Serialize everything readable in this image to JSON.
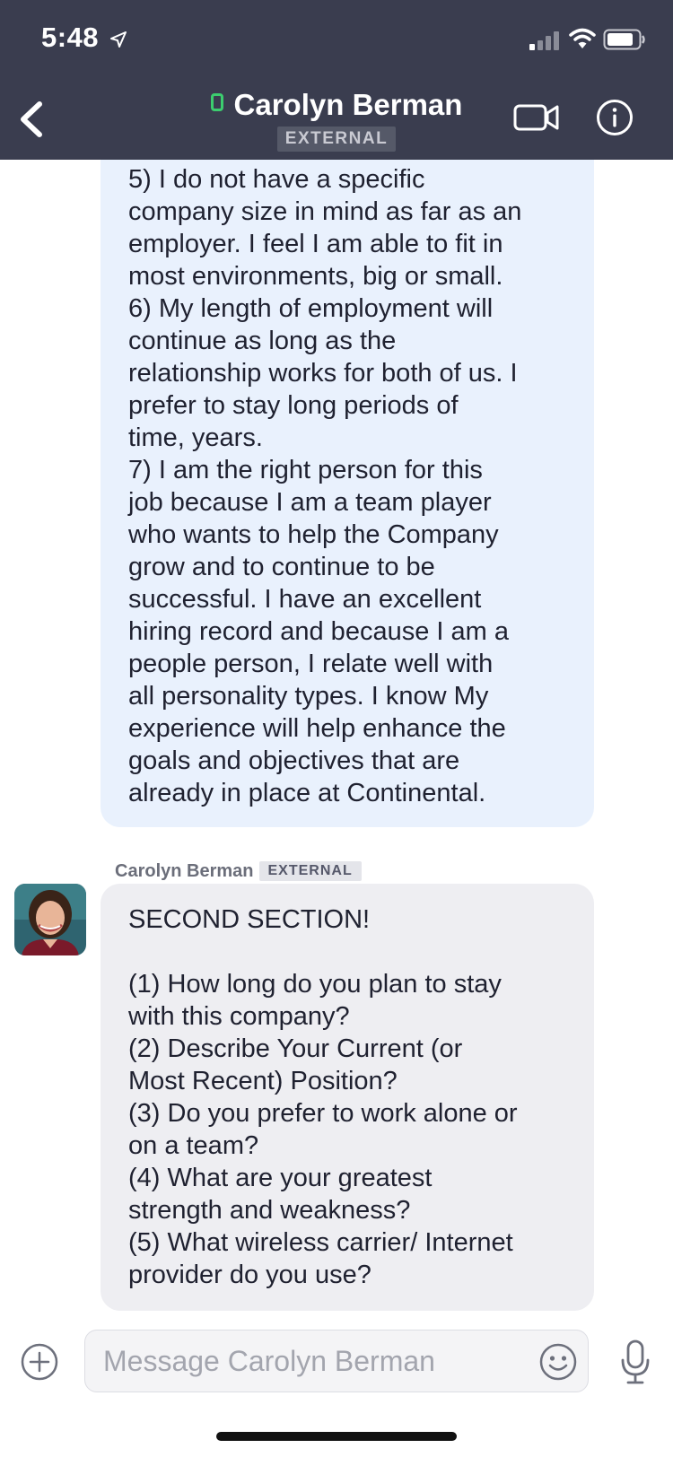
{
  "status_bar": {
    "time": "5:48"
  },
  "header": {
    "contact_name": "Carolyn Berman",
    "badge": "EXTERNAL"
  },
  "messages": [
    {
      "text": "5) I do not have a specific\ncompany size in mind as far as an\nemployer. I feel I am able to fit in\nmost environments, big or small.\n6) My length of employment will\ncontinue as long as the\nrelationship works for both of us. I\nprefer to stay long periods of\ntime, years.\n7) I am the right person for this\njob because I am a team player\nwho wants to help the Company\ngrow and to continue to be\nsuccessful. I have an excellent\nhiring record and because I am a\npeople person, I relate well with\nall personality types. I know My\nexperience will help enhance the\ngoals and objectives that are\nalready in place at Continental."
    },
    {
      "sender": "Carolyn Berman",
      "badge": "EXTERNAL",
      "text": "SECOND SECTION!\n\n(1) How long do you plan to stay\nwith this company?\n(2) Describe Your Current (or\nMost Recent) Position?\n(3) Do you prefer to work alone or\non a team?\n(4) What are your greatest\nstrength and weakness?\n(5) What wireless carrier/ Internet\nprovider do you use?"
    }
  ],
  "composer": {
    "placeholder": "Message Carolyn Berman",
    "value": ""
  },
  "icons": {
    "location": "location-arrow-icon",
    "signal": "cellular-signal-icon",
    "wifi": "wifi-icon",
    "battery": "battery-icon",
    "back": "chevron-left-icon",
    "video": "video-camera-icon",
    "info": "info-icon",
    "add": "plus-circle-icon",
    "emoji": "smiley-icon",
    "mic": "microphone-icon"
  },
  "colors": {
    "header_bg": "#3a3d4f",
    "presence": "#3ccd6f",
    "own_bubble": "#e9f1fd",
    "other_bubble": "#eeeef2"
  }
}
